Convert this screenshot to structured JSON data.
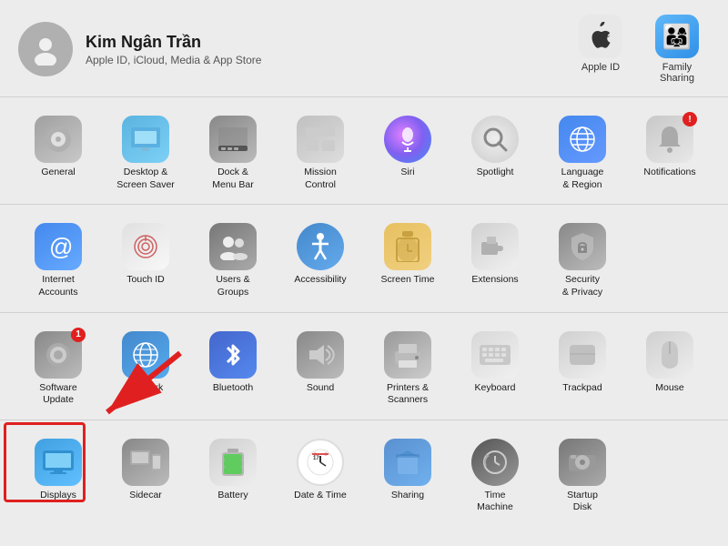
{
  "profile": {
    "name": "Kim Ngân Trần",
    "subtitle": "Apple ID, iCloud, Media & App Store",
    "avatar_label": "user-avatar"
  },
  "header_actions": [
    {
      "id": "apple-id",
      "label": "Apple ID",
      "icon": "apple-icon"
    },
    {
      "id": "family-sharing",
      "label": "Family Sharing",
      "icon": "family-icon"
    }
  ],
  "sections": [
    {
      "id": "section1",
      "items": [
        {
          "id": "general",
          "label": "General",
          "icon": "⚙️",
          "badge": null
        },
        {
          "id": "desktop-screensaver",
          "label": "Desktop &\nScreen Saver",
          "icon": "🖥️",
          "badge": null
        },
        {
          "id": "dock-menubar",
          "label": "Dock &\nMenu Bar",
          "icon": "📊",
          "badge": null
        },
        {
          "id": "mission-control",
          "label": "Mission\nControl",
          "icon": "▣",
          "badge": null
        },
        {
          "id": "siri",
          "label": "Siri",
          "icon": "🎤",
          "badge": null
        },
        {
          "id": "spotlight",
          "label": "Spotlight",
          "icon": "🔍",
          "badge": null
        },
        {
          "id": "language-region",
          "label": "Language\n& Region",
          "icon": "🌐",
          "badge": null
        },
        {
          "id": "notifications",
          "label": "Notifications",
          "icon": "🔔",
          "badge": "!"
        }
      ]
    },
    {
      "id": "section2",
      "items": [
        {
          "id": "internet-accounts",
          "label": "Internet\nAccounts",
          "icon": "@",
          "badge": null
        },
        {
          "id": "touch-id",
          "label": "Touch ID",
          "icon": "👆",
          "badge": null
        },
        {
          "id": "users-groups",
          "label": "Users &\nGroups",
          "icon": "👥",
          "badge": null
        },
        {
          "id": "accessibility",
          "label": "Accessibility",
          "icon": "♿",
          "badge": null
        },
        {
          "id": "screen-time",
          "label": "Screen Time",
          "icon": "⏳",
          "badge": null
        },
        {
          "id": "extensions",
          "label": "Extensions",
          "icon": "🧩",
          "badge": null
        },
        {
          "id": "security-privacy",
          "label": "Security\n& Privacy",
          "icon": "🔒",
          "badge": null
        }
      ]
    },
    {
      "id": "section3",
      "items": [
        {
          "id": "software-update",
          "label": "Software\nUpdate",
          "icon": "⚙",
          "badge": "1"
        },
        {
          "id": "network",
          "label": "Network",
          "icon": "🌐",
          "badge": null
        },
        {
          "id": "bluetooth",
          "label": "Bluetooth",
          "icon": "₿",
          "badge": null
        },
        {
          "id": "sound",
          "label": "Sound",
          "icon": "🔊",
          "badge": null
        },
        {
          "id": "printers-scanners",
          "label": "Printers &\nScanners",
          "icon": "🖨️",
          "badge": null
        },
        {
          "id": "keyboard",
          "label": "Keyboard",
          "icon": "⌨️",
          "badge": null
        },
        {
          "id": "trackpad",
          "label": "Trackpad",
          "icon": "▭",
          "badge": null
        },
        {
          "id": "mouse",
          "label": "Mouse",
          "icon": "🖱️",
          "badge": null
        }
      ]
    },
    {
      "id": "section4",
      "items": [
        {
          "id": "displays",
          "label": "Displays",
          "icon": "🖥",
          "badge": null,
          "highlighted": true
        },
        {
          "id": "sidecar",
          "label": "Sidecar",
          "icon": "📱",
          "badge": null
        },
        {
          "id": "battery",
          "label": "Battery",
          "icon": "🔋",
          "badge": null
        },
        {
          "id": "date-time",
          "label": "Date & Time",
          "icon": "🕐",
          "badge": null
        },
        {
          "id": "sharing",
          "label": "Sharing",
          "icon": "📁",
          "badge": null
        },
        {
          "id": "time-machine",
          "label": "Time\nMachine",
          "icon": "⏱",
          "badge": null
        },
        {
          "id": "startup-disk",
          "label": "Startup\nDisk",
          "icon": "💽",
          "badge": null
        }
      ]
    }
  ],
  "arrow": {
    "visible": true
  },
  "highlight": {
    "visible": true
  }
}
